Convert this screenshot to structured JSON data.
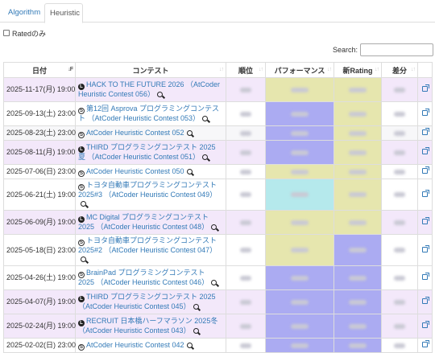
{
  "tabs": [
    {
      "label": "Algorithm",
      "active": false
    },
    {
      "label": "Heuristic",
      "active": true
    }
  ],
  "rated_only_label": "Ratedのみ",
  "search": {
    "label": "Search:",
    "value": ""
  },
  "columns": [
    "日付",
    "コンテスト",
    "順位",
    "パフォーマンス",
    "新Rating",
    "差分",
    ""
  ],
  "colors": {
    "row_purple": "#f3e8fa",
    "row_white": "#ffffff",
    "row_gray": "#f7f7f9",
    "yellow": "#e6e6ae",
    "blue": "#ababf2",
    "cyan": "#b5e9ec",
    "pink": "#f3e8fa"
  },
  "rows": [
    {
      "date": "2025-11-17(月) 19:00",
      "rated_type": "L",
      "contest": "HACK TO THE FUTURE 2026 （AtCoder Heuristic Contest 056）",
      "bg": "row_purple",
      "perf": "yellow",
      "rating": "yellow"
    },
    {
      "date": "2025-09-13(土) 23:00",
      "rated_type": "S",
      "contest": "第12回 Asprova プログラミングコンテスト （AtCoder Heuristic Contest 053）",
      "bg": "row_white",
      "perf": "blue",
      "rating": "yellow"
    },
    {
      "date": "2025-08-23(土) 23:00",
      "rated_type": "S",
      "contest": "AtCoder Heuristic Contest 052",
      "bg": "row_gray",
      "perf": "blue",
      "rating": "yellow"
    },
    {
      "date": "2025-08-11(月) 19:00",
      "rated_type": "L",
      "contest": "THIRD プログラミングコンテスト 2025 夏 （AtCoder Heuristic Contest 051）",
      "bg": "row_purple",
      "perf": "blue",
      "rating": "yellow"
    },
    {
      "date": "2025-07-06(日) 23:00",
      "rated_type": "S",
      "contest": "AtCoder Heuristic Contest 050",
      "bg": "row_white",
      "perf": "yellow",
      "rating": "yellow"
    },
    {
      "date": "2025-06-21(土) 19:00",
      "rated_type": "S",
      "contest": "トヨタ自動車プログラミングコンテスト 2025#3 （AtCoder Heuristic Contest 049）",
      "bg": "row_white",
      "perf": "cyan",
      "rating": "yellow"
    },
    {
      "date": "2025-06-09(月) 19:00",
      "rated_type": "L",
      "contest": "MC Digital プログラミングコンテスト2025 （AtCoder Heuristic Contest 048）",
      "bg": "row_purple",
      "perf": "yellow",
      "rating": "yellow"
    },
    {
      "date": "2025-05-18(日) 23:00",
      "rated_type": "S",
      "contest": "トヨタ自動車プログラミングコンテスト 2025#2 （AtCoder Heuristic Contest 047）",
      "bg": "row_white",
      "perf": "yellow",
      "rating": "blue"
    },
    {
      "date": "2025-04-26(土) 19:00",
      "rated_type": "S",
      "contest": "BrainPad プログラミングコンテスト 2025 （AtCoder Heuristic Contest 046）",
      "bg": "row_white",
      "perf": "blue",
      "rating": "blue"
    },
    {
      "date": "2025-04-07(月) 19:00",
      "rated_type": "L",
      "contest": "THIRD プログラミングコンテスト 2025 （AtCoder Heuristic Contest 045）",
      "bg": "row_purple",
      "perf": "blue",
      "rating": "blue"
    },
    {
      "date": "2025-02-24(月) 19:00",
      "rated_type": "L",
      "contest": "RECRUIT 日本橋ハーフマラソン 2025冬 （AtCoder Heuristic Contest 043）",
      "bg": "row_purple",
      "perf": "blue",
      "rating": "blue"
    },
    {
      "date": "2025-02-02(日) 23:00",
      "rated_type": "S",
      "contest": "AtCoder Heuristic Contest 042",
      "bg": "row_white",
      "perf": "blue",
      "rating": "blue"
    }
  ]
}
